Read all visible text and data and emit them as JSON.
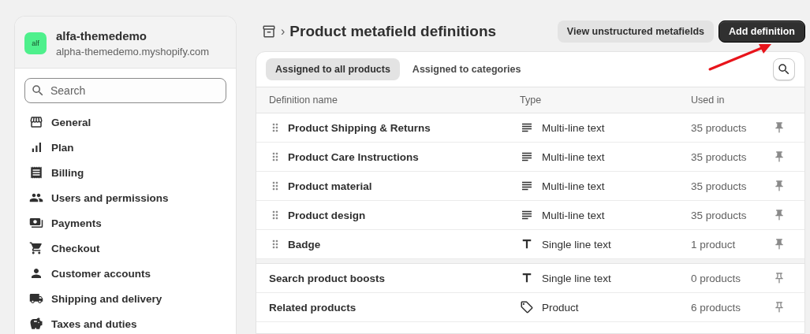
{
  "store": {
    "avatar": "alf",
    "name": "alfa-themedemo",
    "domain": "alpha-themedemo.myshopify.com"
  },
  "sidebar": {
    "search": {
      "placeholder": "Search"
    },
    "items": [
      {
        "label": "General"
      },
      {
        "label": "Plan"
      },
      {
        "label": "Billing"
      },
      {
        "label": "Users and permissions"
      },
      {
        "label": "Payments"
      },
      {
        "label": "Checkout"
      },
      {
        "label": "Customer accounts"
      },
      {
        "label": "Shipping and delivery"
      },
      {
        "label": "Taxes and duties"
      }
    ]
  },
  "breadcrumb": {
    "separator": "›",
    "title": "Product metafield definitions"
  },
  "buttons": [
    {
      "label": "View unstructured metafields",
      "kind": "secondary"
    },
    {
      "label": "Add definition",
      "kind": "primary"
    }
  ],
  "tabs": [
    {
      "label": "Assigned to all products",
      "selected": true
    },
    {
      "label": "Assigned to categories",
      "selected": false
    }
  ],
  "table": {
    "columns": [
      "Definition name",
      "Type",
      "Used in"
    ],
    "pinned_rows": [
      {
        "name": "Product Shipping & Returns",
        "type": "Multi-line text",
        "kind": "multiline",
        "used_in": "35 products",
        "pinned": true
      },
      {
        "name": "Product Care Instructions",
        "type": "Multi-line text",
        "kind": "multiline",
        "used_in": "35 products",
        "pinned": true
      },
      {
        "name": "Product material",
        "type": "Multi-line text",
        "kind": "multiline",
        "used_in": "35 products",
        "pinned": true
      },
      {
        "name": "Product design",
        "type": "Multi-line text",
        "kind": "multiline",
        "used_in": "35 products",
        "pinned": true
      },
      {
        "name": "Badge",
        "type": "Single line text",
        "kind": "single",
        "used_in": "1 product",
        "pinned": true
      }
    ],
    "other_rows": [
      {
        "name": "Search product boosts",
        "type": "Single line text",
        "kind": "single_list",
        "used_in": "0 products",
        "pinned": false
      },
      {
        "name": "Related products",
        "type": "Product",
        "kind": "product",
        "used_in": "6 products",
        "pinned": false
      }
    ]
  }
}
